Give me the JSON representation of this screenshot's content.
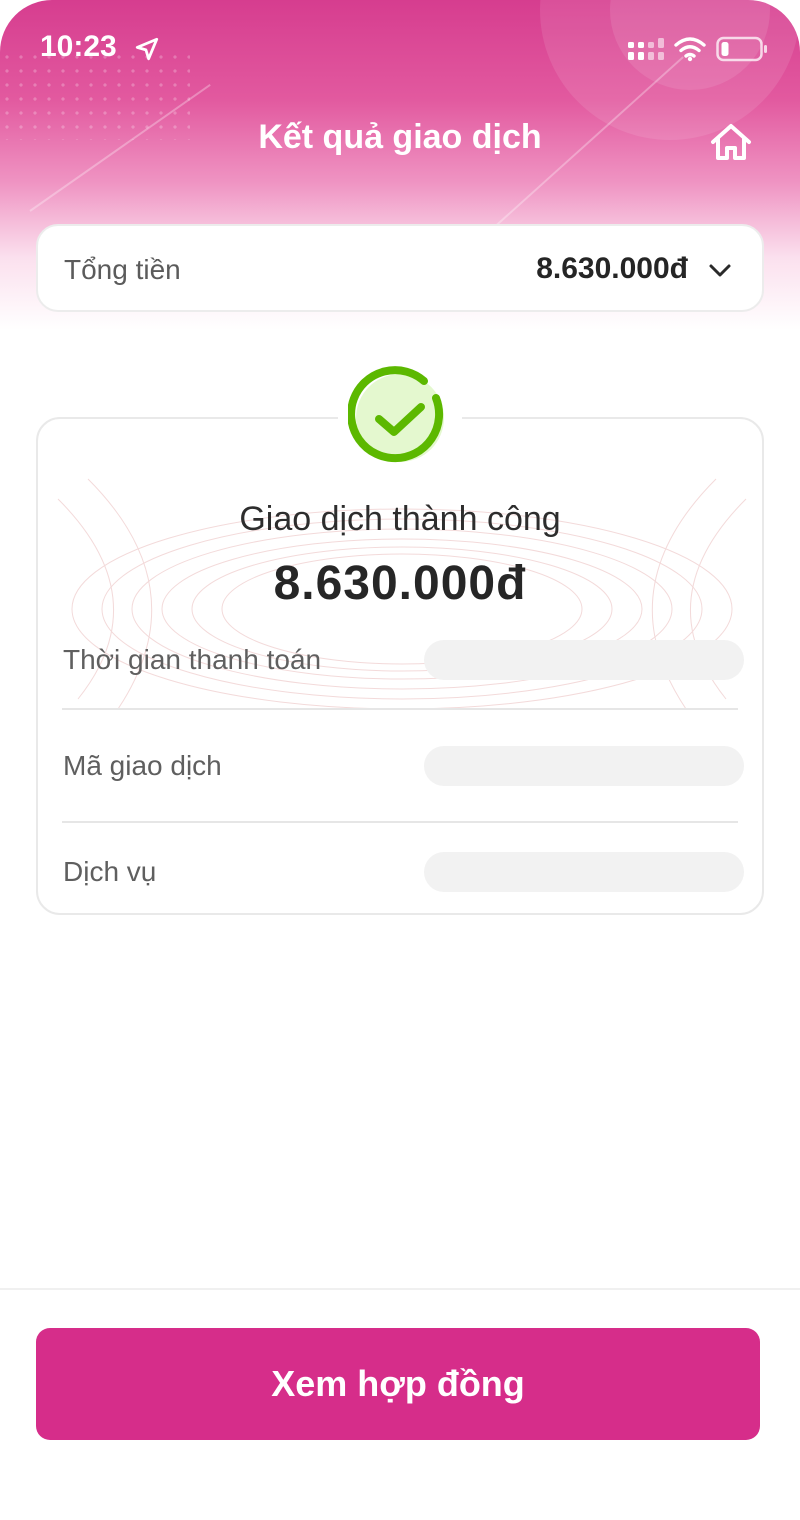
{
  "status_bar": {
    "time": "10:23",
    "icons": [
      "location-arrow-icon",
      "cellular-signal-icon",
      "wifi-icon",
      "battery-icon"
    ]
  },
  "header": {
    "title": "Kết quả giao dịch",
    "home_icon": "home-icon"
  },
  "total": {
    "label": "Tổng tiền",
    "value": "8.630.000đ",
    "expand_icon": "chevron-down-icon"
  },
  "result": {
    "status_icon": "success-check-icon",
    "status": "Giao dịch thành công",
    "amount": "8.630.000đ",
    "rows": [
      {
        "label": "Thời gian thanh toán",
        "value": ""
      },
      {
        "label": "Mã giao dịch",
        "value": ""
      },
      {
        "label": "Dịch vụ",
        "value": ""
      }
    ]
  },
  "footer": {
    "button_label": "Xem hợp đồng"
  },
  "colors": {
    "brand_primary": "#d62d8a",
    "header_gradient_top": "#d63d8f",
    "success_green": "#5cb800",
    "success_fill": "#e4f8cf"
  }
}
